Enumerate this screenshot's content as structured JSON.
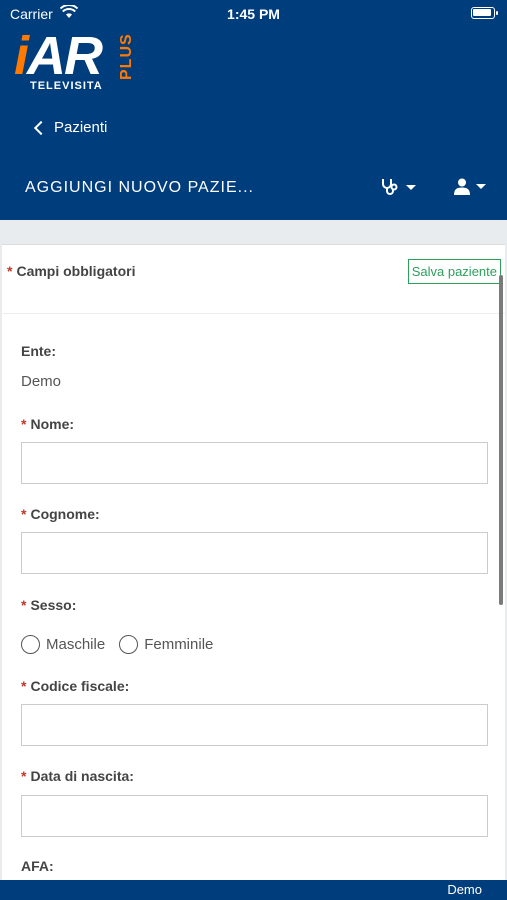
{
  "status_bar": {
    "carrier": "Carrier",
    "time": "1:45 PM"
  },
  "logo": {
    "i": "i",
    "ar": "AR",
    "plus": "PLUS",
    "subtitle": "TELEVISITA"
  },
  "nav": {
    "back_label": "Pazienti",
    "page_title": "AGGIUNGI NUOVO PAZIE..."
  },
  "icons": {
    "doctor_menu": "stethoscope-icon",
    "user_menu": "user-icon"
  },
  "colors": {
    "header": "#003d7c",
    "accent": "#ff7a00",
    "save": "#2e9e5b",
    "required": "#c0392b"
  },
  "form": {
    "required_note": "Campi obbligatori",
    "save_label": "Salva paziente",
    "ente_label": "Ente:",
    "ente_value": "Demo",
    "nome_label": "Nome:",
    "nome_value": "",
    "cognome_label": "Cognome:",
    "cognome_value": "",
    "sesso_label": "Sesso:",
    "sesso_options": [
      "Maschile",
      "Femminile"
    ],
    "codice_fiscale_label": "Codice fiscale:",
    "codice_fiscale_value": "",
    "data_nascita_label": "Data di nascita:",
    "data_nascita_value": "",
    "afa_label": "AFA:"
  },
  "footer": {
    "text": "Demo"
  }
}
